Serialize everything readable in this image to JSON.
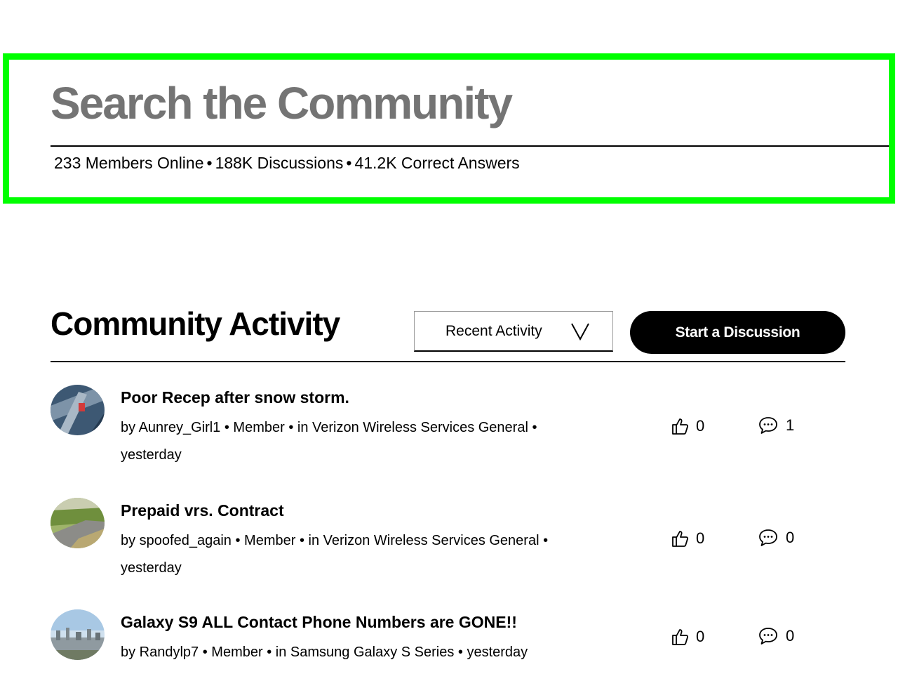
{
  "hero": {
    "title": "Search the Community",
    "stats": {
      "members": "233 Members Online",
      "discussions": "188K Discussions",
      "answers": "41.2K Correct Answers",
      "separator": "•"
    }
  },
  "activity": {
    "title": "Community Activity",
    "filter": {
      "selected": "Recent Activity",
      "icon": "chevron-down-icon"
    },
    "start_button_label": "Start a Discussion",
    "posts": [
      {
        "title": "Poor Recep after snow storm.",
        "author": "by Aunrey_Girl1",
        "role": "• Member •",
        "board": "in Verizon Wireless Services General •",
        "time": "yesterday",
        "likes": "0",
        "replies": "1"
      },
      {
        "title": "Prepaid vrs. Contract",
        "author": "by spoofed_again",
        "role": "• Member •",
        "board": "in Verizon Wireless Services General •",
        "time": "yesterday",
        "likes": "0",
        "replies": "0"
      },
      {
        "title": "Galaxy S9 ALL Contact Phone Numbers are GONE!!",
        "author": "by Randylp7",
        "role": "• Member •",
        "board": "in Samsung Galaxy S Series •",
        "time": "yesterday",
        "likes": "0",
        "replies": "0"
      }
    ]
  },
  "colors": {
    "highlight": "#00ff00",
    "hero_title": "#747474",
    "button_bg": "#000000",
    "button_text": "#ffffff"
  },
  "icons": {
    "like": "thumbs-up-icon",
    "reply": "speech-bubble-icon"
  }
}
